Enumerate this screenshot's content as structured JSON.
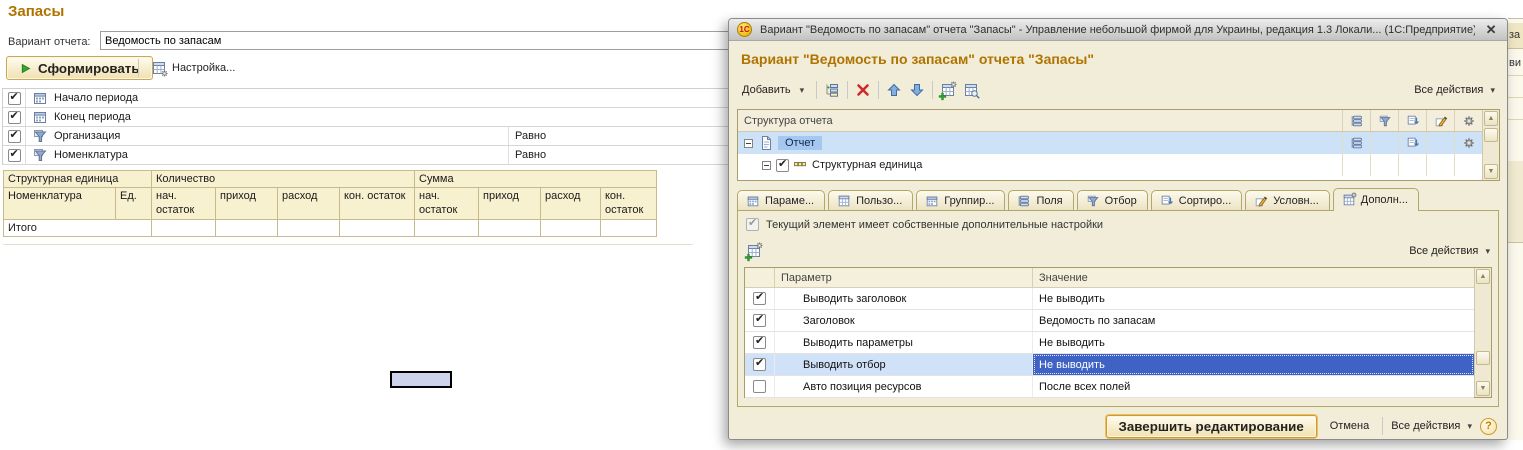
{
  "main": {
    "title": "Запасы",
    "variant_label": "Вариант отчета:",
    "variant_value": "Ведомость по запасам",
    "generate_button": "Сформировать",
    "settings_button": "Настройка...",
    "params": [
      {
        "label": "Начало периода",
        "condition": ""
      },
      {
        "label": "Конец периода",
        "condition": ""
      },
      {
        "label": "Организация",
        "condition": "Равно"
      },
      {
        "label": "Номенклатура",
        "condition": "Равно"
      }
    ],
    "report_table": {
      "group_headers": [
        "Структурная единица",
        "Количество",
        "Сумма"
      ],
      "columns": [
        "Номенклатура",
        "Ед.",
        "нач. остаток",
        "приход",
        "расход",
        "кон. остаток",
        "нач. остаток",
        "приход",
        "расход",
        "кон. остаток"
      ],
      "total_label": "Итого"
    },
    "edge_fragments": [
      "за",
      "ви"
    ]
  },
  "dialog": {
    "window_title": "Вариант \"Ведомость по запасам\" отчета \"Запасы\" - Управление небольшой фирмой для Украины, редакция 1.3 Локали...  (1С:Предприятие)",
    "header": "Вариант \"Ведомость по запасам\" отчета \"Запасы\"",
    "toolbar": {
      "add_label": "Добавить",
      "all_actions_label": "Все действия"
    },
    "tree": {
      "header": "Структура отчета",
      "rows": [
        {
          "label": "Отчет"
        },
        {
          "label": "Структурная единица"
        }
      ]
    },
    "tabs": [
      "Параме...",
      "Пользо...",
      "Группир...",
      "Поля",
      "Отбор",
      "Сортиро...",
      "Условн...",
      "Дополн..."
    ],
    "panel": {
      "own_settings_label": "Текущий элемент имеет собственные дополнительные настройки",
      "all_actions_label": "Все действия",
      "table": {
        "col_param": "Параметр",
        "col_value": "Значение",
        "rows": [
          {
            "param": "Выводить заголовок",
            "value": "Не выводить"
          },
          {
            "param": "Заголовок",
            "value": "Ведомость по запасам"
          },
          {
            "param": "Выводить параметры",
            "value": "Не выводить"
          },
          {
            "param": "Выводить отбор",
            "value": "Не выводить"
          },
          {
            "param": "Авто позиция ресурсов",
            "value": "После всех полей"
          }
        ]
      }
    },
    "footer": {
      "finish_label": "Завершить редактирование",
      "cancel_label": "Отмена",
      "all_actions_label": "Все действия",
      "help_label": "?"
    }
  }
}
